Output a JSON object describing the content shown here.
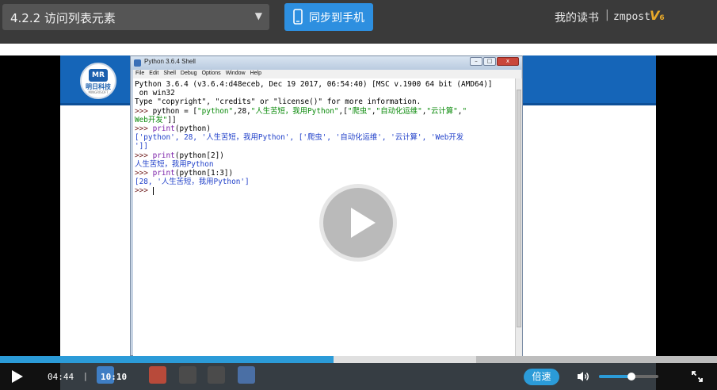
{
  "topbar": {
    "chapter_title": "4.2.2 访问列表元素",
    "sync_label": "同步到手机",
    "my_books": "我的读书",
    "separator": "|",
    "username": "zmpost",
    "vip_badge": "V",
    "vip_sub": "6"
  },
  "shell": {
    "title": "Python 3.6.4 Shell",
    "menu": [
      "File",
      "Edit",
      "Shell",
      "Debug",
      "Options",
      "Window",
      "Help"
    ],
    "win_buttons": {
      "minimize": "–",
      "maximize": "□",
      "close": "x"
    }
  },
  "logo": {
    "mark": "MR",
    "name": "明日科技",
    "sub": "MINGRISOFT"
  },
  "player": {
    "current_time": "04:44",
    "time_separator": "|",
    "total_time": "10:10",
    "speed_label": "倍速",
    "progress_played": 0.465,
    "progress_buffered": 0.664,
    "volume": 0.55,
    "accent_color": "#2b9bd8"
  }
}
